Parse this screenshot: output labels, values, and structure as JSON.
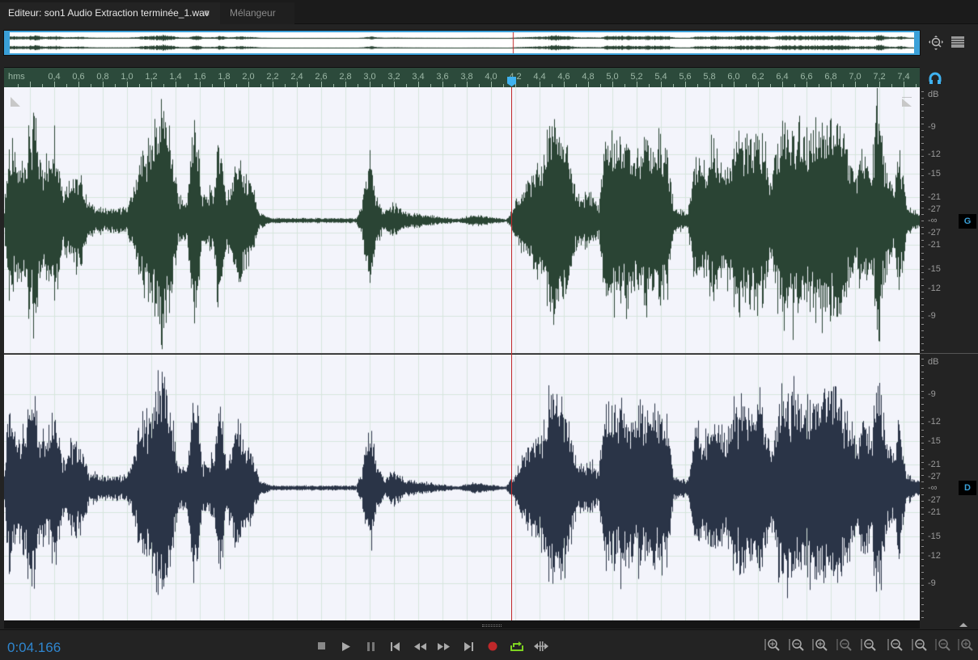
{
  "tabs": {
    "editor_label": "Editeur: son1 Audio Extraction terminée_1.wav *",
    "menu_icon": "≡",
    "mixer_label": "Mélangeur"
  },
  "ruler": {
    "unit": "hms",
    "labels": [
      "0,4",
      "0,6",
      "0,8",
      "1,0",
      "1,2",
      "1,4",
      "1,6",
      "1,8",
      "2,0",
      "2,2",
      "2,4",
      "2,6",
      "2,8",
      "3,0",
      "3,2",
      "3,4",
      "3,6",
      "3,8",
      "4,0",
      "4,2",
      "4,4",
      "4,6",
      "4,8",
      "5,0",
      "5,2",
      "5,4",
      "5,6",
      "5,8",
      "6,0",
      "6,2",
      "6,4",
      "6,6",
      "6,8",
      "7,0",
      "7,2",
      "7,4"
    ],
    "start_seconds": 0.4,
    "step_seconds": 0.2
  },
  "playhead_seconds": 4.166,
  "channels": [
    {
      "badge": "G",
      "color": "#2a4434",
      "db_labels": [
        "dB",
        "-9",
        "-12",
        "-15",
        "-21",
        "-27",
        "-∞",
        "-27",
        "-21",
        "-15",
        "-12",
        "-9"
      ]
    },
    {
      "badge": "D",
      "color": "#2a3447",
      "db_labels": [
        "dB",
        "-9",
        "-12",
        "-15",
        "-21",
        "-27",
        "-∞",
        "-27",
        "-21",
        "-15",
        "-12",
        "-9"
      ]
    }
  ],
  "transport": {
    "time": "0:04.166",
    "buttons": [
      "stop",
      "play",
      "pause",
      "move-to-previous",
      "rewind",
      "fast-forward",
      "move-to-next",
      "record",
      "loop-playback",
      "skip-selection"
    ]
  },
  "zoom_buttons": [
    "zoom-in-amplitude",
    "zoom-out-amplitude",
    "zoom-in-time",
    "zoom-out-time",
    "zoom-out-full",
    "zoom-in-at-in-point",
    "zoom-in-at-out-point",
    "zoom-to-selection",
    "zoom-to-selected-channel"
  ],
  "colors": {
    "accent": "#3aa0d8",
    "playhead": "#c0282a",
    "ruler": "#2c4a3b",
    "time": "#2f86cf",
    "loop": "#7ed321"
  }
}
